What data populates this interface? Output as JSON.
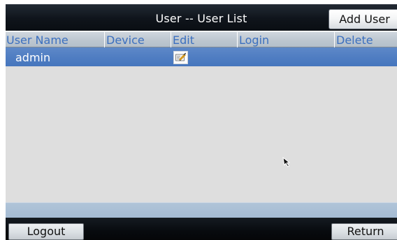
{
  "titlebar": {
    "title": "User -- User List",
    "add_user_label": "Add User"
  },
  "table": {
    "columns": [
      "User Name",
      "Device",
      "Edit",
      "Login",
      "Delete"
    ],
    "rows": [
      {
        "user_name": "admin",
        "edit_icon": "edit-pencil-icon"
      }
    ]
  },
  "footer": {
    "logout_label": "Logout",
    "return_label": "Return"
  },
  "colors": {
    "header_text": "#3c70bf",
    "selected_row": "#4f7dc2",
    "list_background": "#dedede",
    "status_strip": "#a8bfd5",
    "bar_dark": "#0b0f14"
  },
  "icons": {
    "edit": "edit-pencil-icon",
    "pointer": "mouse-cursor-icon"
  }
}
